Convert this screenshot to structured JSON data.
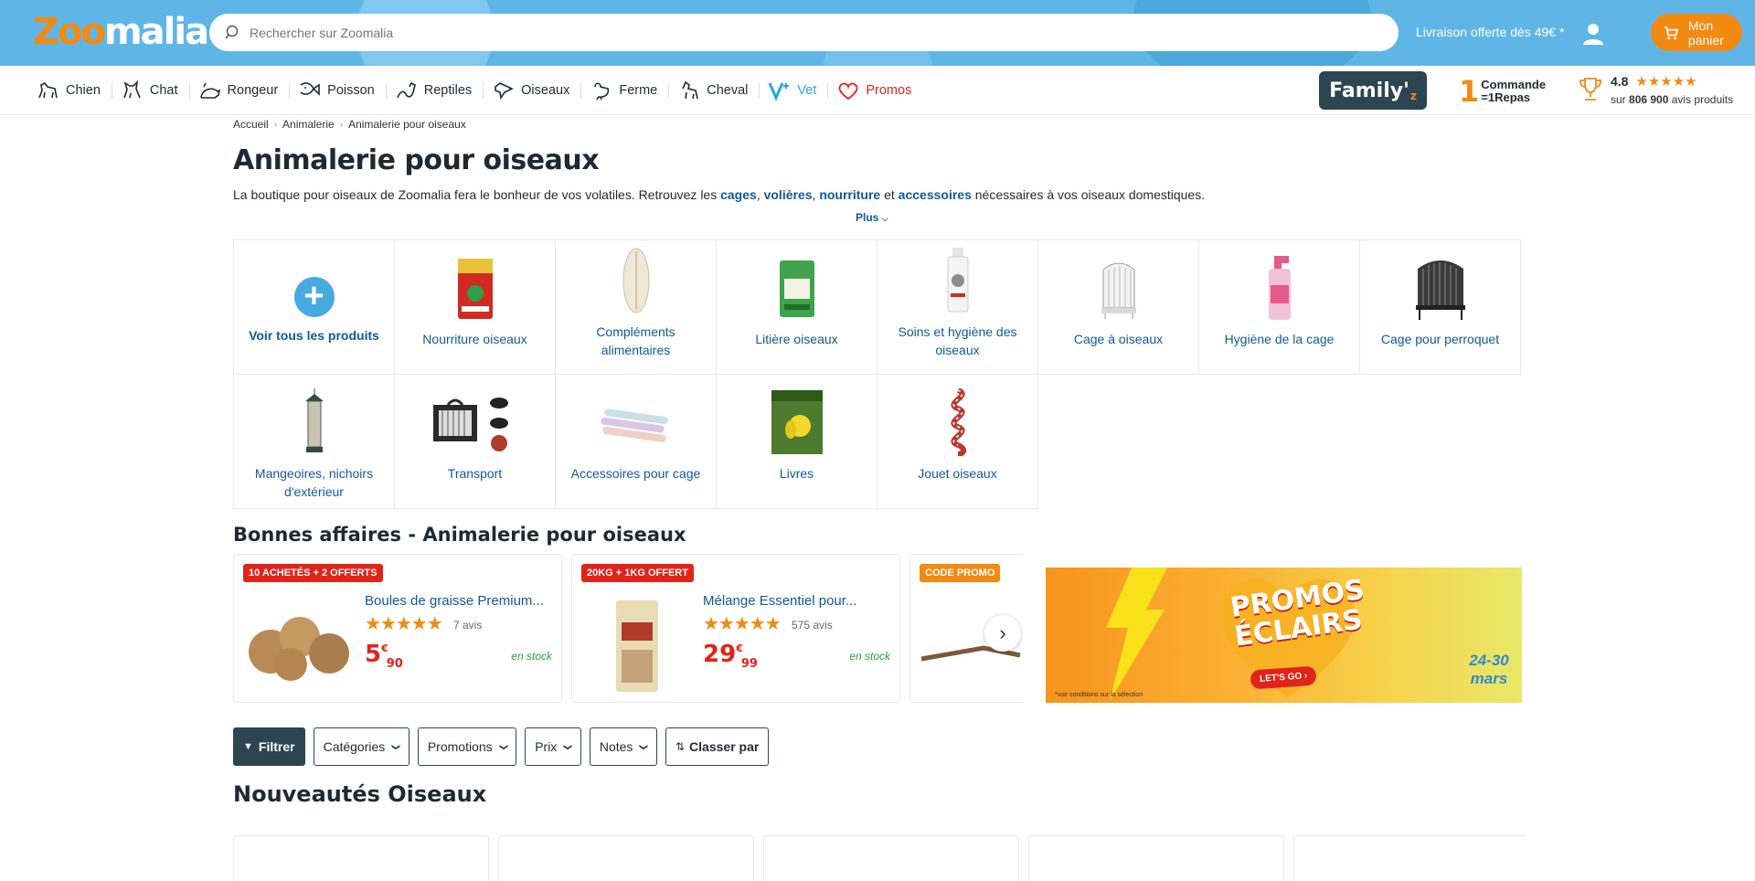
{
  "header": {
    "logo_part1": "Zoo",
    "logo_part2": "malia",
    "search_placeholder": "Rechercher sur Zoomalia",
    "delivery_text": "Livraison offerte dès 49€ *",
    "cart_label": "Mon panier",
    "colors": {
      "header_bg": "#5fb6e6",
      "brand_orange": "#f28a12"
    }
  },
  "nav": {
    "items": [
      {
        "label": "Chien",
        "icon": "dog-icon"
      },
      {
        "label": "Chat",
        "icon": "cat-icon"
      },
      {
        "label": "Rongeur",
        "icon": "rodent-icon"
      },
      {
        "label": "Poisson",
        "icon": "fish-icon"
      },
      {
        "label": "Reptiles",
        "icon": "reptile-icon"
      },
      {
        "label": "Oiseaux",
        "icon": "bird-icon"
      },
      {
        "label": "Ferme",
        "icon": "farm-icon"
      },
      {
        "label": "Cheval",
        "icon": "horse-icon"
      },
      {
        "label": "Vet",
        "icon": "vet-icon"
      },
      {
        "label": "Promos",
        "icon": "heart-icon"
      }
    ],
    "familyz": "Family'",
    "familyz_sub": "z",
    "repas_big": "1",
    "repas_line1": "Commande",
    "repas_line2": "=1Repas",
    "rating_score": "4.8",
    "rating_stars": "★★★★★",
    "rating_prefix": "sur",
    "rating_count": "806 900",
    "rating_suffix": "avis produits"
  },
  "breadcrumb": [
    "Accueil",
    "Animalerie",
    "Animalerie pour oiseaux"
  ],
  "page": {
    "title": "Animalerie pour oiseaux",
    "intro_start": "La boutique pour oiseaux de Zoomalia fera le bonheur de vos volatiles. Retrouvez les ",
    "link_cages": "cages",
    "sep1": ", ",
    "link_volieres": "volières",
    "sep2": ", ",
    "link_nourriture": "nourriture",
    "sep3": " et ",
    "link_accessoires": "accessoires",
    "intro_end": " nécessaires à vos oiseaux domestiques.",
    "more": "Plus"
  },
  "categories": [
    {
      "label": "Voir tous les produits"
    },
    {
      "label": "Nourriture oiseaux"
    },
    {
      "label": "Compléments alimentaires"
    },
    {
      "label": "Litière oiseaux"
    },
    {
      "label": "Soins et hygiène des oiseaux"
    },
    {
      "label": "Cage à oiseaux"
    },
    {
      "label": "Hygiène de la cage"
    },
    {
      "label": "Cage pour perroquet"
    },
    {
      "label": "Mangeoires, nichoirs d'extérieur"
    },
    {
      "label": "Transport"
    },
    {
      "label": "Accessoires pour cage"
    },
    {
      "label": "Livres"
    },
    {
      "label": "Jouet oiseaux"
    }
  ],
  "deals": {
    "title": "Bonnes affaires - Animalerie pour oiseaux",
    "items": [
      {
        "badge": "10 ACHETÉS + 2 OFFERTS",
        "name": "Boules de graisse Premium...",
        "stars": "★★★★★",
        "reviews": "7 avis",
        "price_int": "5",
        "price_cur": "€",
        "price_dec": "90",
        "stock": "en stock"
      },
      {
        "badge": "20KG + 1KG OFFERT",
        "name": "Mélange Essentiel pour...",
        "stars": "★★★★★",
        "reviews": "575 avis",
        "price_int": "29",
        "price_cur": "€",
        "price_dec": "99",
        "stock": "en stock"
      },
      {
        "badge": "CODE PROMO"
      }
    ]
  },
  "promo_banner": {
    "title": "PROMOS ÉCLAIRS",
    "cta": "LET'S GO",
    "dates": "24-30 mars",
    "conditions": "*voir conditions sur la sélection"
  },
  "filters": {
    "filter": "Filtrer",
    "categories": "Catégories",
    "promotions": "Promotions",
    "price": "Prix",
    "notes": "Notes",
    "sort": "Classer par"
  },
  "new_section": {
    "title": "Nouveautés Oiseaux"
  }
}
